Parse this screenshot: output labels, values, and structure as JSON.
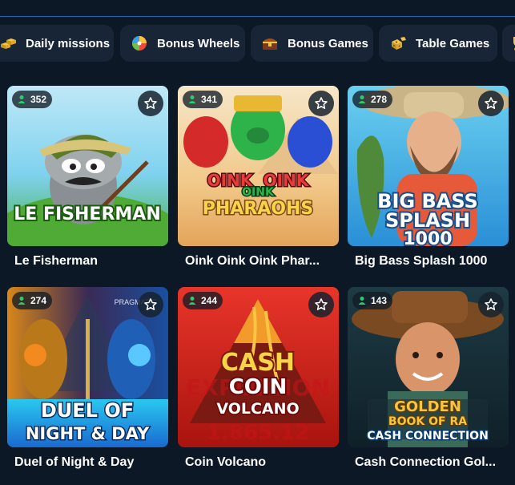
{
  "categories": [
    {
      "label": "Daily missions",
      "icon": "gold-bars-icon"
    },
    {
      "label": "Bonus Wheels",
      "icon": "wheel-icon"
    },
    {
      "label": "Bonus Games",
      "icon": "treasure-chest-icon"
    },
    {
      "label": "Table Games",
      "icon": "dice-icon"
    },
    {
      "label": "",
      "icon": "trophy-icon"
    }
  ],
  "games": [
    {
      "title": "Le Fisherman",
      "players": "352",
      "art_text": [
        "LE FISHERMAN"
      ]
    },
    {
      "title": "Oink Oink Oink Phar...",
      "players": "341",
      "art_text": [
        "OINK",
        "OINK",
        "OINK",
        "PHARAOHS"
      ]
    },
    {
      "title": "Big Bass Splash 1000",
      "players": "278",
      "art_text": [
        "BIG BASS",
        "SPLASH",
        "1000"
      ]
    },
    {
      "title": "Duel of Night & Day",
      "players": "274",
      "art_text": [
        "PRAGMATIC",
        "DUEL OF",
        "NIGHT & DAY"
      ]
    },
    {
      "title": "Coin Volcano",
      "players": "244",
      "art_text": [
        "CASH",
        "COIN",
        "VOLCANO",
        "EXPLOSION",
        "1.865.12"
      ]
    },
    {
      "title": "Cash Connection Gol...",
      "players": "143",
      "art_text": [
        "GOLDEN",
        "BOOK OF RA",
        "CASH CONNECTION"
      ]
    }
  ],
  "colors": {
    "background": "#0c1826",
    "chip_bg": "#172536",
    "online": "#2ecc71"
  }
}
